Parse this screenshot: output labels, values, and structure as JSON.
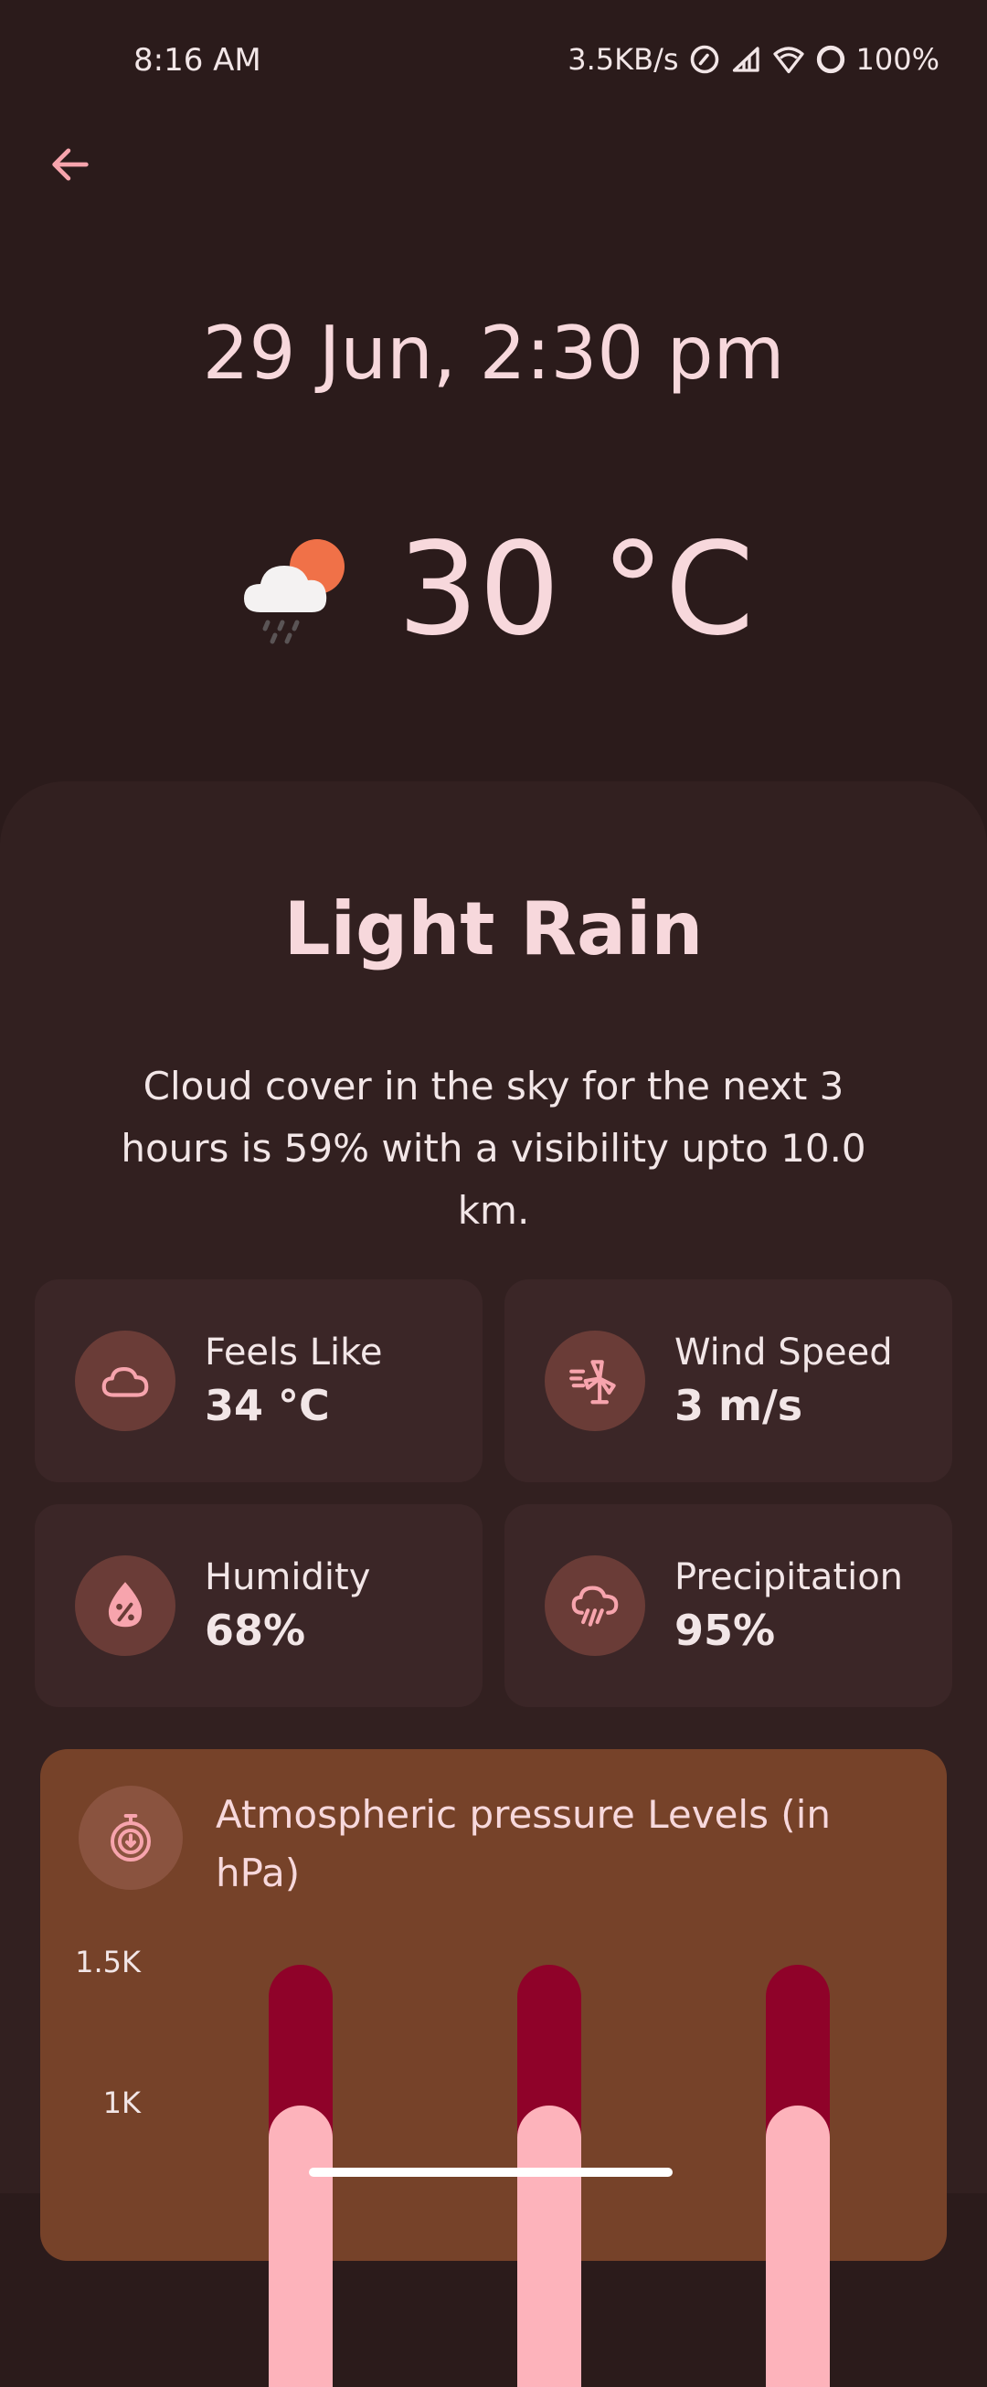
{
  "status_bar": {
    "time": "8:16 AM",
    "network_speed": "3.5KB/s",
    "battery": "100%",
    "icons": [
      "alarm-icon",
      "signal-icon",
      "wifi-icon",
      "battery-icon"
    ]
  },
  "header": {
    "back_icon": "arrow-left-icon"
  },
  "forecast": {
    "datetime": "29 Jun, 2:30 pm",
    "temperature": "30 °C",
    "weather_icon": "cloud-sun-rain-icon",
    "condition": "Light Rain",
    "description": "Cloud cover in the sky for the next 3 hours is 59% with a visibility upto 10.0 km."
  },
  "stats": [
    {
      "label": "Feels Like",
      "value": "34 °C",
      "icon": "cloud-icon"
    },
    {
      "label": "Wind Speed",
      "value": "3 m/s",
      "icon": "windmill-icon"
    },
    {
      "label": "Humidity",
      "value": "68%",
      "icon": "water-drop-percent-icon"
    },
    {
      "label": "Precipitation",
      "value": "95%",
      "icon": "rain-cloud-icon"
    }
  ],
  "pressure": {
    "title": "Atmospheric pressure Levels (in hPa)",
    "icon": "pressure-gauge-icon"
  },
  "chart_data": {
    "type": "bar",
    "title": "Atmospheric pressure Levels (in hPa)",
    "ytick_labels": [
      "1.5K",
      "1K"
    ],
    "ylim": [
      0,
      1500
    ],
    "values": [
      1000,
      1000,
      1000
    ],
    "max_values": [
      1500,
      1500,
      1500
    ],
    "colors": {
      "track": "#8f0229",
      "fill": "#fdb3bb"
    }
  },
  "colors": {
    "background": "#2b1b1b",
    "sheet": "#322020",
    "card": "#3b2627",
    "icon_circle": "#6a3c37",
    "accent": "#f7a4ad",
    "pressure_card": "#764229"
  }
}
